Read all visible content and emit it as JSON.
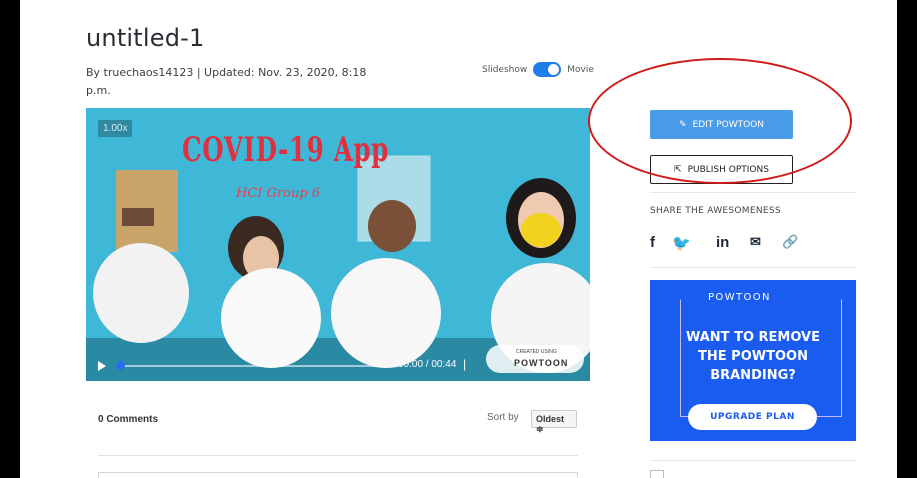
{
  "header": {
    "title": "untitled-1",
    "byline": "By truechaos14123 | Updated: Nov. 23, 2020, 8:18 p.m.",
    "toggle_left": "Slideshow",
    "toggle_right": "Movie"
  },
  "video": {
    "speed": "1.00x",
    "headline": "COVID-19 App",
    "subline": "HCI Group 6",
    "time": "00:00 / 00:44",
    "separator": "|",
    "brand_small": "CREATED USING",
    "brand_name": "POWTOON",
    "progress": 0
  },
  "comments": {
    "count_label": "0 Comments",
    "sort_label": "Sort by",
    "sort_value": "Oldest ≑"
  },
  "sidebar": {
    "edit_label": "EDIT POWTOON",
    "publish_label": "PUBLISH OPTIONS",
    "share_title": "SHARE THE AWESOMENESS",
    "social": [
      "f",
      "🐦",
      "in",
      "✉",
      "🔗"
    ]
  },
  "ad": {
    "brand": "POWTOON",
    "text": "WANT TO REMOVE THE POWTOON BRANDING?",
    "cta": "UPGRADE PLAN"
  },
  "colors": {
    "accent": "#4a9ce8",
    "ad_bg": "#1a5cf0",
    "annotation": "#d11b1b"
  }
}
